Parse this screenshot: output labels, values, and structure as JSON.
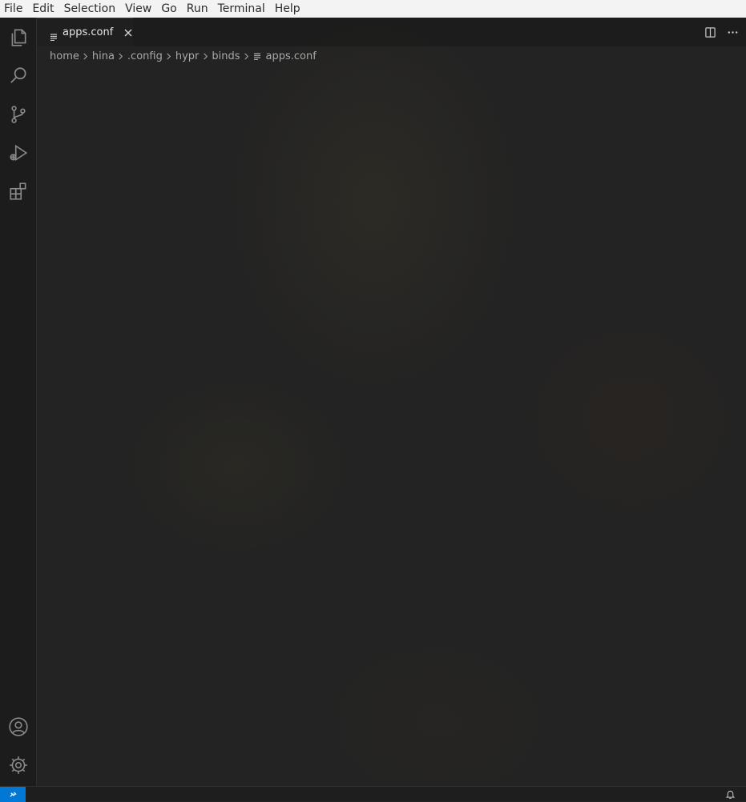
{
  "menubar": {
    "items": [
      "File",
      "Edit",
      "Selection",
      "View",
      "Go",
      "Run",
      "Terminal",
      "Help"
    ]
  },
  "activitybar": {
    "top_icons": [
      "explorer-icon",
      "search-icon",
      "source-control-icon",
      "run-debug-icon",
      "extensions-icon"
    ],
    "bottom_icons": [
      "account-icon",
      "settings-gear-icon"
    ]
  },
  "editor": {
    "tab": {
      "label": "apps.conf",
      "icon": "file-lines-icon"
    },
    "tab_actions": [
      "split-editor-icon",
      "more-actions-icon"
    ],
    "breadcrumb": [
      "home",
      "hina",
      ".config",
      "hypr",
      "binds",
      "apps.conf"
    ]
  },
  "statusbar": {
    "remote_icon": "remote-icon",
    "bell_icon": "bell-icon"
  },
  "colors": {
    "accent": "#0078d4",
    "menubar_bg": "#f3f3f3",
    "editor_bg": "#232323"
  }
}
